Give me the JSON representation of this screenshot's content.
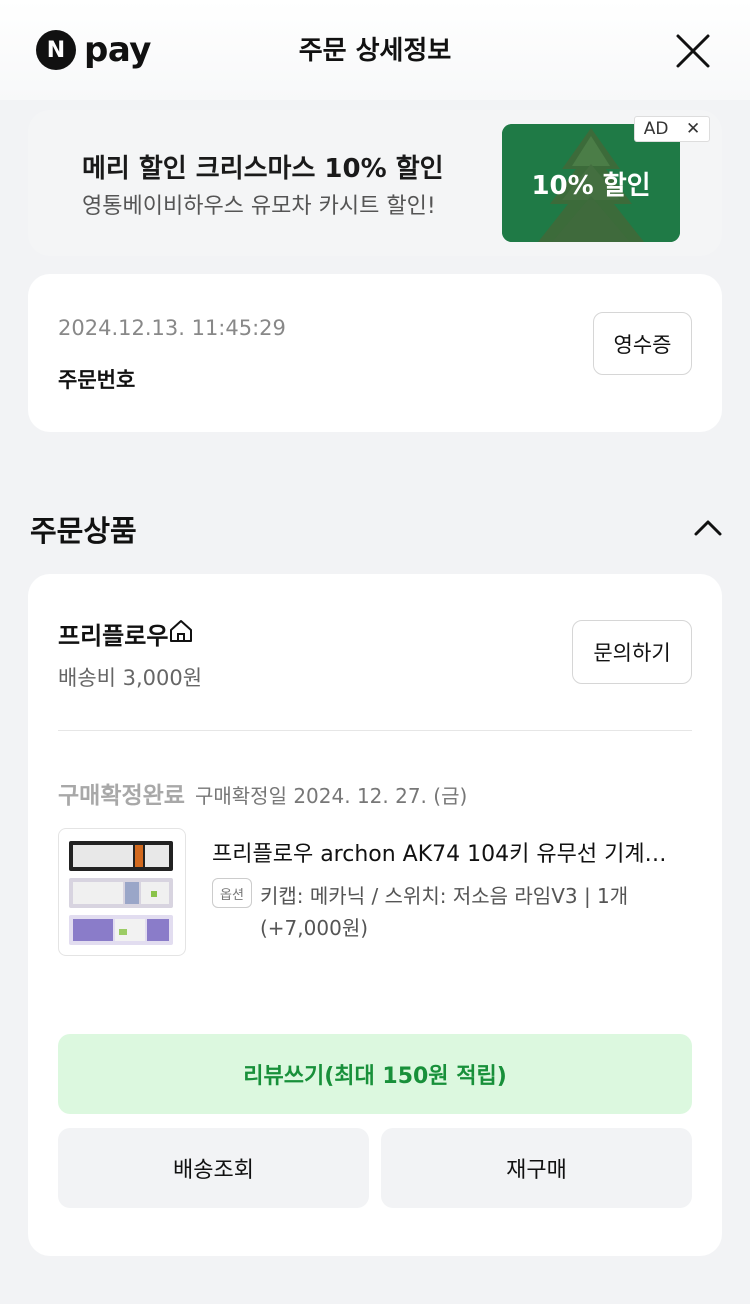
{
  "header": {
    "logo_mark": "N",
    "logo_text": "pay",
    "title": "주문 상세정보"
  },
  "ad": {
    "title": "메리 할인 크리스마스 10% 할인",
    "subtitle": "영통베이비하우스 유모차 카시트 할인!",
    "image_text": "10% 할인",
    "badge": "AD",
    "badge_close": "✕"
  },
  "order": {
    "datetime": "2024.12.13. 11:45:29",
    "number_label": "주문번호",
    "receipt_label": "영수증"
  },
  "section": {
    "title": "주문상품"
  },
  "seller": {
    "name": "프리플로우",
    "shipping_fee": "배송비 3,000원",
    "inquiry_label": "문의하기"
  },
  "item": {
    "status": "구매확정완료",
    "confirm_date": "구매확정일 2024. 12. 27. (금)",
    "name": "프리플로우 archon AK74 104키 유무선 기계…",
    "option_tag": "옵션",
    "option_text": "키캡: 메카닉 / 스위치: 저소음 라임V3 | 1개 (+7,000원)"
  },
  "actions": {
    "review": "리뷰쓰기(최대 150원 적립)",
    "tracking": "배송조회",
    "reorder": "재구매"
  },
  "colors": {
    "accent_green": "#18903a",
    "review_bg": "#dcf8df",
    "ad_green": "#1f7a46"
  }
}
